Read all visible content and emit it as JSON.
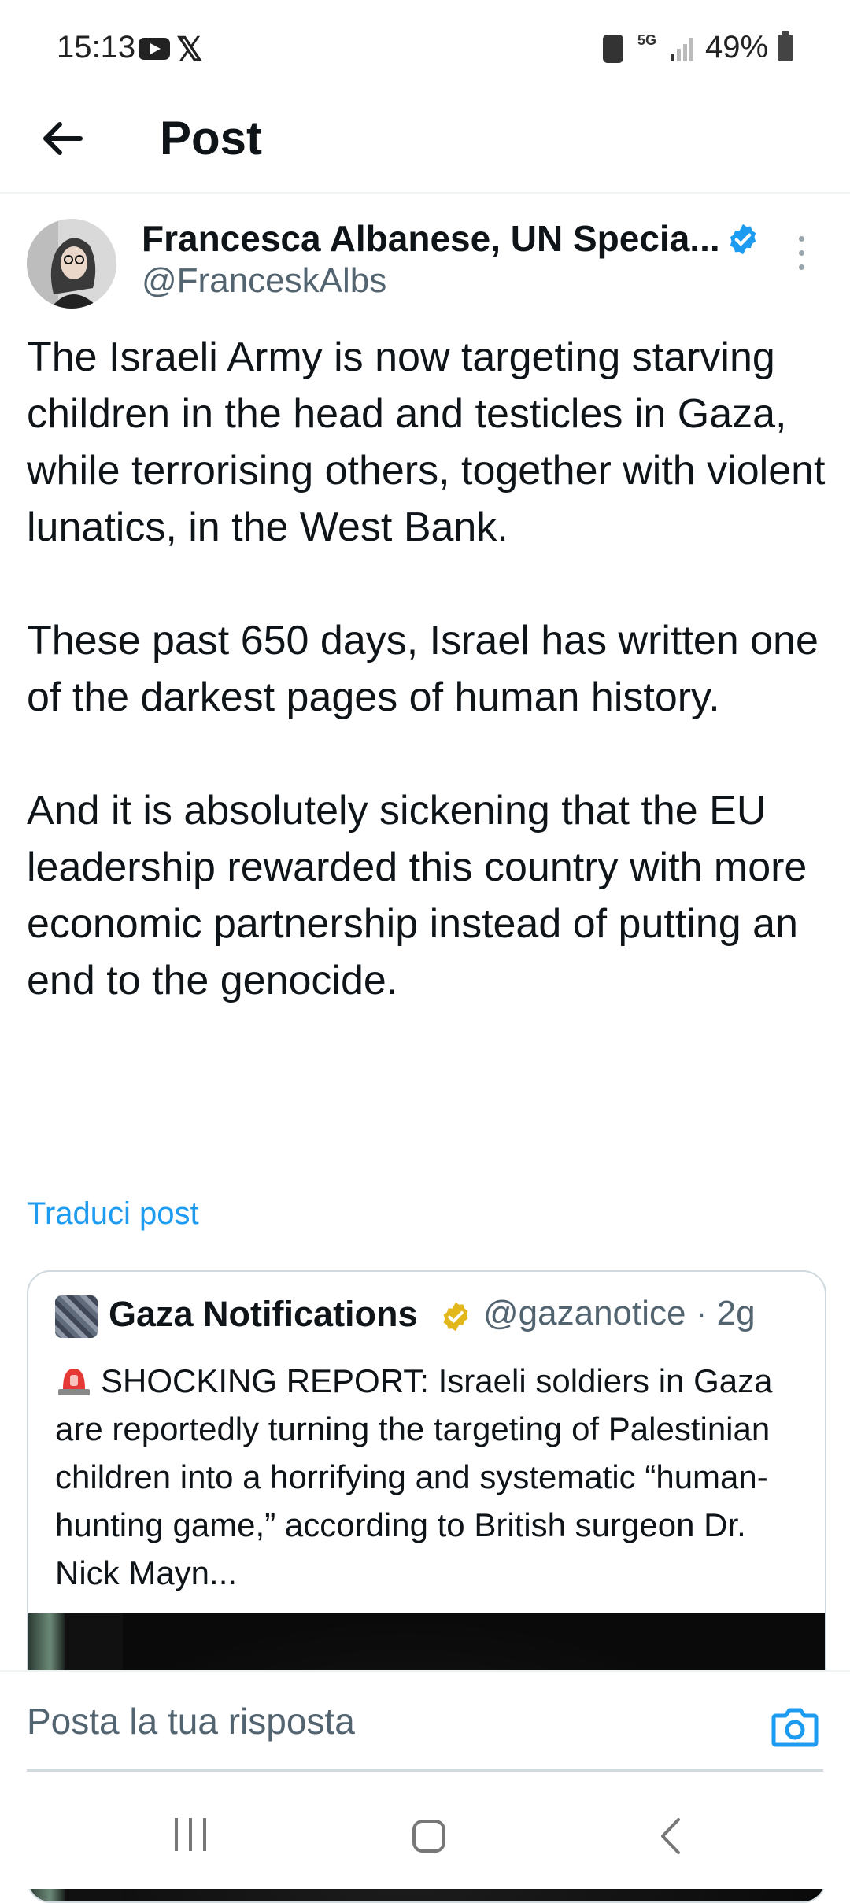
{
  "status_bar": {
    "time": "15:13",
    "network": "5G",
    "battery": "49%",
    "icons": [
      "youtube-icon",
      "x-icon",
      "battery-saver-icon",
      "signal-icon",
      "battery-icon"
    ]
  },
  "header": {
    "title": "Post"
  },
  "post": {
    "author_name": "Francesca Albanese, UN Specia...",
    "author_handle": "@FranceskAlbs",
    "verified_color": "#1d9bf0",
    "paragraphs": [
      "The Israeli Army is now targeting starving children in the head and testicles in Gaza, while terrorising others, together with violent lunatics, in the West Bank.",
      "These past 650 days, Israel has written one of the darkest pages of human history.",
      "And it is absolutely sickening that the EU leadership rewarded this country with more economic partnership instead of putting an end to the genocide."
    ],
    "translate_label": "Traduci post"
  },
  "quote": {
    "name": "Gaza Notifications",
    "handle_time": "@gazanotice · 2g",
    "badge_color": "#e2b719",
    "text": "SHOCKING REPORT: Israeli soldiers in Gaza are reportedly turning the targeting of Palestinian children into a horrifying and systematic “human-hunting game,” according to British surgeon Dr. Nick Mayn..."
  },
  "reply": {
    "placeholder": "Posta la tua risposta"
  },
  "colors": {
    "accent": "#1d9bf0",
    "secondary_text": "#536471"
  }
}
